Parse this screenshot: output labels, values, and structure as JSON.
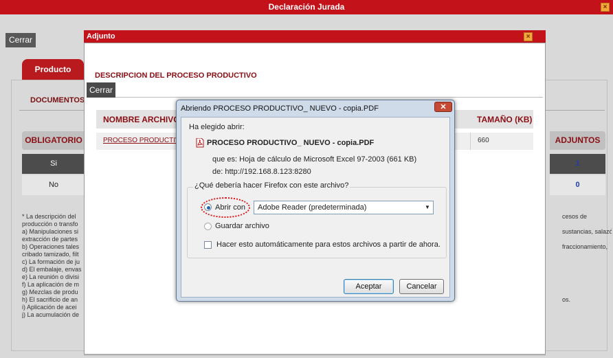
{
  "outer": {
    "title": "Declaración Jurada",
    "close_glyph": "×",
    "cerrar_label": "Cerrar",
    "tab_label": "Producto",
    "documentos_label": "DOCUMENTOS",
    "col_obligatorio": "OBLIGATORIO",
    "col_adjuntos": "ADJUNTOS",
    "rows": [
      {
        "obligatorio": "Si",
        "adjuntos": "1"
      },
      {
        "obligatorio": "No",
        "adjuntos": "0"
      }
    ],
    "left_notes": [
      "* La descripción del",
      "producción o transfo",
      "a) Manipulaciones si",
      "extracción de partes",
      "b) Operaciones tales",
      "cribado tamizado, filt",
      "c) La formación de ju",
      "d) El embalaje, envas",
      "e) La reunión o divisi",
      "f) La aplicación de m",
      "g) Mezclas de produ",
      "h) El sacrificio de an",
      "i) Aplicación de acei",
      "j) La acumulación de"
    ],
    "right_notes": [
      "cesos de",
      "",
      "sustancias, salazón,",
      "",
      "fraccionamiento,",
      "",
      "",
      "",
      "",
      "",
      "",
      "os."
    ]
  },
  "adjunto": {
    "title": "Adjunto",
    "close_glyph": "×",
    "heading": "DESCRIPCION DEL PROCESO PRODUCTIVO",
    "cerrar_label": "Cerrar",
    "col_nombre": "NOMBRE ARCHIVO",
    "col_tamano": "TAMAÑO (KB)",
    "file_link": "PROCESO PRODUCTIVO",
    "file_size": "660"
  },
  "firefox_dialog": {
    "title": "Abriendo PROCESO PRODUCTIVO_ NUEVO - copia.PDF",
    "close_glyph": "✕",
    "elegido": "Ha elegido abrir:",
    "filename": "PROCESO PRODUCTIVO_ NUEVO - copia.PDF",
    "que_es": "que es:  Hoja de cálculo de Microsoft Excel 97-2003 (661 KB)",
    "de": "de:  http://192.168.8.123:8280",
    "question": "¿Qué debería hacer Firefox con este archivo?",
    "abrir_con": "Abrir con",
    "app_selected": "Adobe Reader  (predeterminada)",
    "guardar": "Guardar archivo",
    "auto_label": "Hacer esto automáticamente para estos archivos a partir de ahora.",
    "aceptar": "Aceptar",
    "cancelar": "Cancelar",
    "selected_option": "abrir_con",
    "auto_checked": false
  },
  "colors": {
    "brand_red": "#c4121a",
    "header_text_red": "#8b0e13",
    "link_blue": "#1e3fa8"
  }
}
